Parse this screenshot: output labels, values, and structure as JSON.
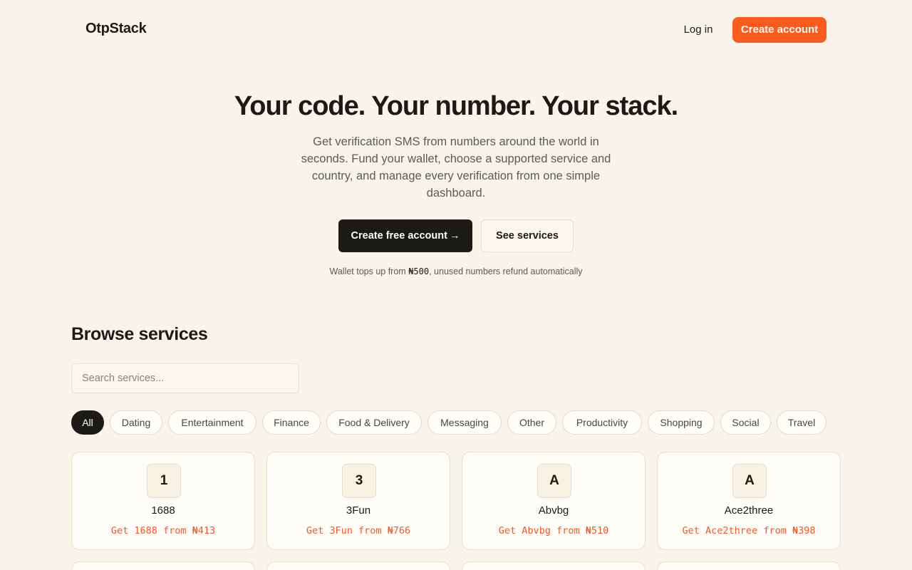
{
  "brand": {
    "name": "OtpStack"
  },
  "nav": {
    "login_label": "Log in",
    "create_account_label": "Create account"
  },
  "hero": {
    "title": "Your code. Your number. Your stack.",
    "subtitle": "Get verification SMS from numbers around the world in seconds. Fund your wallet, choose a supported service and country, and manage every verification from one simple dashboard.",
    "primary_cta": "Create free account",
    "primary_cta_arrow": "→",
    "secondary_cta": "See services",
    "hint_prefix": "Wallet tops up from ",
    "hint_price": "₦500",
    "hint_suffix": ", unused numbers refund automatically"
  },
  "services": {
    "heading": "Browse services",
    "search_placeholder": "Search services...",
    "categories": [
      "All",
      "Dating",
      "Entertainment",
      "Finance",
      "Food & Delivery",
      "Messaging",
      "Other",
      "Productivity",
      "Shopping",
      "Social",
      "Travel"
    ],
    "active_category": "All",
    "items": [
      {
        "initial": "1",
        "name": "1688",
        "offer": "Get 1688 from ₦413"
      },
      {
        "initial": "3",
        "name": "3Fun",
        "offer": "Get 3Fun from ₦766"
      },
      {
        "initial": "A",
        "name": "Abvbg",
        "offer": "Get Abvbg from ₦510"
      },
      {
        "initial": "A",
        "name": "Ace2three",
        "offer": "Get Ace2three from ₦398"
      }
    ]
  },
  "colors": {
    "background": "#f9f4ea",
    "accent": "#fd5a1e",
    "dark": "#1c1a17",
    "offer_text": "#f1592a"
  }
}
